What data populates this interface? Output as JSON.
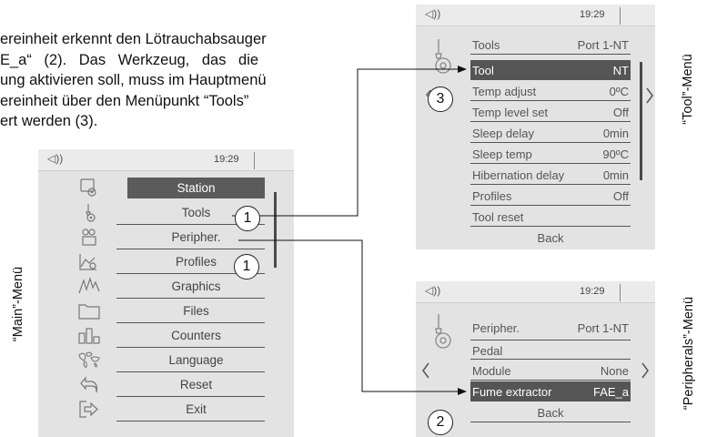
{
  "intro": {
    "lines": [
      "ereinheit erkennt den Lötrauchabsauger",
      "E_a“ (2). Das Werkzeug, das die",
      "ung aktivieren soll, muss im Hauptmenü",
      "ereinheit über den Menüpunkt “Tools”",
      "ert werden (3)."
    ]
  },
  "status_bar": {
    "speaker_icon": "speaker-icon",
    "time": "19:29"
  },
  "main_menu": {
    "side_label": "“Main”-Menü",
    "items": [
      {
        "label": "Station",
        "icon": "station-icon",
        "selected": true
      },
      {
        "label": "Tools",
        "icon": "soldering-iron-icon"
      },
      {
        "label": "Peripher.",
        "icon": "peripherals-icon"
      },
      {
        "label": "Profiles",
        "icon": "profiles-icon"
      },
      {
        "label": "Graphics",
        "icon": "graphics-icon"
      },
      {
        "label": "Files",
        "icon": "folder-icon"
      },
      {
        "label": "Counters",
        "icon": "counters-icon"
      },
      {
        "label": "Language",
        "icon": "world-map-icon"
      },
      {
        "label": "Reset",
        "icon": "reset-icon"
      },
      {
        "label": "Exit",
        "icon": "exit-icon"
      }
    ]
  },
  "tool_menu": {
    "side_label": "“Tool”-Menü",
    "header": {
      "title": "Tools",
      "value": "Port 1-NT"
    },
    "rows": [
      {
        "label": "Tool",
        "value": "NT",
        "selected": true
      },
      {
        "label": "Temp adjust",
        "value": "0ºC"
      },
      {
        "label": "Temp level set",
        "value": "Off"
      },
      {
        "label": "Sleep delay",
        "value": "0min"
      },
      {
        "label": "Sleep temp",
        "value": "90ºC"
      },
      {
        "label": "Hibernation delay",
        "value": "0min"
      },
      {
        "label": "Profiles",
        "value": "Off"
      },
      {
        "label": "Tool reset",
        "value": ""
      }
    ],
    "back": "Back"
  },
  "peripherals_menu": {
    "side_label": "“Peripherals”-Menü",
    "header": {
      "title": "Peripher.",
      "value": "Port 1-NT"
    },
    "rows": [
      {
        "label": "Pedal",
        "value": ""
      },
      {
        "label": "Module",
        "value": "None"
      },
      {
        "label": "Fume extractor",
        "value": "FAE_a",
        "selected": true
      }
    ],
    "back": "Back"
  },
  "callouts": {
    "one": "1",
    "two": "2",
    "three": "3"
  },
  "colors": {
    "panel_bg": "#e3e3e3",
    "selected_bg": "#5b5b5b",
    "line": "#555555"
  }
}
